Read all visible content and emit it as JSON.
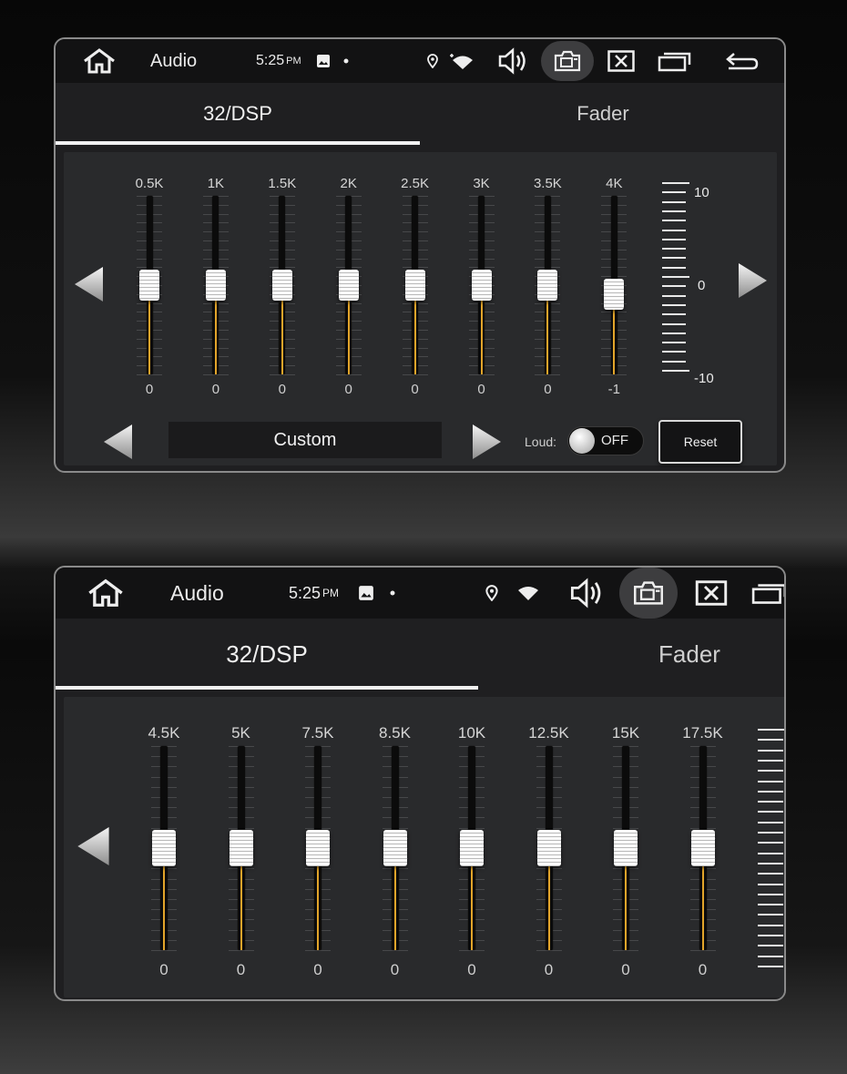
{
  "status_bar": {
    "title": "Audio",
    "time": "5:25",
    "ampm": "PM",
    "icons": [
      "home-icon",
      "image-icon",
      "dot-icon",
      "location-icon",
      "wifi-icon",
      "volume-icon",
      "camera-icon",
      "close-box-icon",
      "windows-icon",
      "back-icon"
    ]
  },
  "tabs": [
    {
      "label": "32/DSP",
      "active": true
    },
    {
      "label": "Fader",
      "active": false
    }
  ],
  "eq_page1": {
    "bands": [
      {
        "label": "0.5K",
        "value": "0"
      },
      {
        "label": "1K",
        "value": "0"
      },
      {
        "label": "1.5K",
        "value": "0"
      },
      {
        "label": "2K",
        "value": "0"
      },
      {
        "label": "2.5K",
        "value": "0"
      },
      {
        "label": "3K",
        "value": "0"
      },
      {
        "label": "3.5K",
        "value": "0"
      },
      {
        "label": "4K",
        "value": "-1"
      }
    ],
    "scale": {
      "max": "10",
      "mid": "0",
      "min": "-10"
    },
    "preset": "Custom",
    "loud_label": "Loud:",
    "loud_state": "OFF",
    "reset_label": "Reset"
  },
  "eq_page2": {
    "bands": [
      {
        "label": "4.5K",
        "value": "0"
      },
      {
        "label": "5K",
        "value": "0"
      },
      {
        "label": "7.5K",
        "value": "0"
      },
      {
        "label": "8.5K",
        "value": "0"
      },
      {
        "label": "10K",
        "value": "0"
      },
      {
        "label": "12.5K",
        "value": "0"
      },
      {
        "label": "15K",
        "value": "0"
      },
      {
        "label": "17.5K",
        "value": "0"
      }
    ]
  },
  "colors": {
    "accent": "#e2a42a",
    "panel": "#1f1f21",
    "statusbar": "#121213"
  }
}
